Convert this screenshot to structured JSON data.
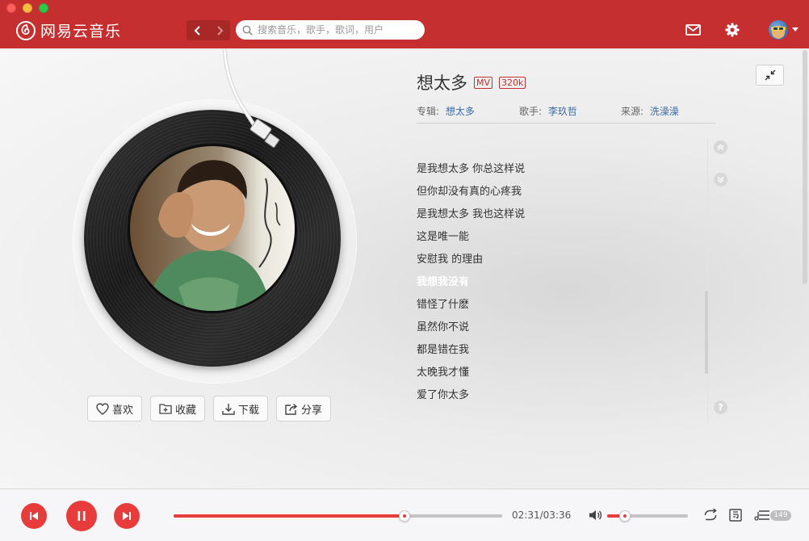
{
  "app": {
    "name": "网易云音乐",
    "accent_color": "#c62f2f"
  },
  "header": {
    "back_icon": "chevron-left-icon",
    "forward_icon": "chevron-right-icon",
    "search_placeholder": "搜索音乐，歌手，歌词，用户",
    "mail_icon": "mail-icon",
    "settings_icon": "gear-icon",
    "avatar_icon": "avatar"
  },
  "song": {
    "title": "想太多",
    "tag_mv": "MV",
    "tag_quality": "320k",
    "album_label": "专辑:",
    "album": "想太多",
    "artist_label": "歌手:",
    "artist": "李玖哲",
    "source_label": "来源:",
    "source": "洗澡澡"
  },
  "actions": {
    "like": "喜欢",
    "collect": "收藏",
    "download": "下载",
    "share": "分享"
  },
  "lyrics": {
    "lines": [
      "是我想太多 你总这样说",
      "但你却没有真的心疼我",
      "是我想太多 我也这样说",
      "这是唯一能",
      "安慰我 的理由",
      "我想我没有",
      "错怪了什麽",
      "虽然你不说",
      "都是错在我",
      "太晚我才懂",
      "爱了你太多"
    ],
    "active_index": 5,
    "help": "?"
  },
  "player": {
    "elapsed": "02:31",
    "duration": "03:36",
    "time_text": "02:31/03:36",
    "progress": 0.703,
    "volume": 0.22,
    "playlist_count": "149",
    "state": "playing"
  }
}
